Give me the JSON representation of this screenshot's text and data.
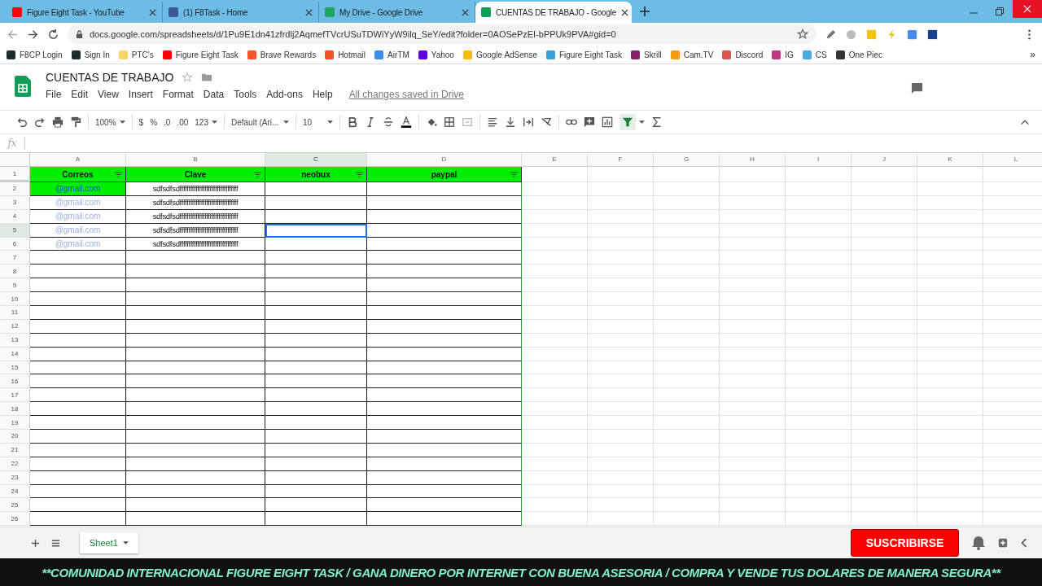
{
  "browser": {
    "tabs": [
      {
        "title": "Figure Eight Task - YouTube",
        "selected": false,
        "color": "#ff0000"
      },
      {
        "title": "(1) F8Task - Home",
        "selected": false,
        "color": "#3b5998"
      },
      {
        "title": "My Drive - Google Drive",
        "selected": false,
        "color": "#1fa463"
      },
      {
        "title": "CUENTAS DE TRABAJO - Google",
        "selected": true,
        "color": "#0f9d58"
      }
    ],
    "url": "docs.google.com/spreadsheets/d/1Pu9E1dn41zfrdlj2AqmefTVcrUSuTDWiYyW9ilq_SeY/edit?folder=0AOSePzEI-bPPUk9PVA#gid=0",
    "bookmarks": [
      {
        "label": "F8CP Login",
        "color": "#1e2b2b"
      },
      {
        "label": "Sign In",
        "color": "#1e2b2b"
      },
      {
        "label": "PTC's",
        "color": "#f6d36b"
      },
      {
        "label": "Figure Eight Task",
        "color": "#ff0000"
      },
      {
        "label": "Brave Rewards",
        "color": "#fb542b"
      },
      {
        "label": "Hotmail",
        "color": "#f25022"
      },
      {
        "label": "AirTM",
        "color": "#3a8ee6"
      },
      {
        "label": "Yahoo",
        "color": "#5f01d1"
      },
      {
        "label": "Google AdSense",
        "color": "#fbbc04"
      },
      {
        "label": "Figure Eight Task",
        "color": "#3aa0d8"
      },
      {
        "label": "Skrill",
        "color": "#862165"
      },
      {
        "label": "Cam.TV",
        "color": "#f39c12"
      },
      {
        "label": "Discord",
        "color": "#d9534f"
      },
      {
        "label": "IG",
        "color": "#c13584"
      },
      {
        "label": "CS",
        "color": "#4aa8e0"
      },
      {
        "label": "One Piec",
        "color": "#333333"
      }
    ],
    "more_bookmarks": "»"
  },
  "doc": {
    "title": "CUENTAS DE TRABAJO",
    "menu": [
      "File",
      "Edit",
      "View",
      "Insert",
      "Format",
      "Data",
      "Tools",
      "Add-ons",
      "Help"
    ],
    "save_status": "All changes saved in Drive"
  },
  "toolbar": {
    "zoom": "100%",
    "currency": "$",
    "percent": "%",
    "decrease_decimals": ".0",
    "increase_decimals": ".00",
    "number_format": "123",
    "font": "Default (Ari...",
    "font_size": "10"
  },
  "formula_bar": {
    "label": "fx"
  },
  "sheet": {
    "columns": [
      {
        "letter": "A",
        "selected": false
      },
      {
        "letter": "B",
        "selected": false
      },
      {
        "letter": "C",
        "selected": true
      },
      {
        "letter": "D",
        "selected": false
      },
      {
        "letter": "E",
        "selected": false
      },
      {
        "letter": "F",
        "selected": false
      },
      {
        "letter": "G",
        "selected": false
      },
      {
        "letter": "H",
        "selected": false
      },
      {
        "letter": "I",
        "selected": false
      },
      {
        "letter": "J",
        "selected": false
      },
      {
        "letter": "K",
        "selected": false
      },
      {
        "letter": "L",
        "selected": false
      }
    ],
    "header_row": {
      "number": "1",
      "labels": [
        "Correos",
        "Clave",
        "neobux",
        "paypal"
      ]
    },
    "rows": [
      {
        "number": "2",
        "email": "@gmail.com",
        "email_highlighted": true,
        "clave": "sdfsdfsdfffffffffffffffffffffffffffffffff",
        "selected": false
      },
      {
        "number": "3",
        "email": "@gmail.com",
        "email_highlighted": false,
        "clave": "sdfsdfsdfffffffffffffffffffffffffffffffff",
        "selected": false
      },
      {
        "number": "4",
        "email": "@gmail.com",
        "email_highlighted": false,
        "clave": "sdfsdfsdfffffffffffffffffffffffffffffffff",
        "selected": false
      },
      {
        "number": "5",
        "email": "@gmail.com",
        "email_highlighted": false,
        "clave": "sdfsdfsdfffffffffffffffffffffffffffffffff",
        "selected": true
      },
      {
        "number": "6",
        "email": "@gmail.com",
        "email_highlighted": false,
        "clave": "sdfsdfsdfffffffffffffffffffffffffffffffff",
        "selected": false
      },
      {
        "number": "7"
      },
      {
        "number": "8"
      },
      {
        "number": "9"
      },
      {
        "number": "10"
      },
      {
        "number": "11"
      },
      {
        "number": "12"
      },
      {
        "number": "13"
      },
      {
        "number": "14"
      },
      {
        "number": "15"
      },
      {
        "number": "16"
      },
      {
        "number": "17"
      },
      {
        "number": "18"
      },
      {
        "number": "19"
      },
      {
        "number": "20"
      },
      {
        "number": "21"
      },
      {
        "number": "22"
      },
      {
        "number": "23"
      },
      {
        "number": "24"
      },
      {
        "number": "25"
      },
      {
        "number": "26"
      }
    ],
    "sheet_tabs": [
      {
        "label": "Sheet1",
        "selected": true
      }
    ]
  },
  "overlay": {
    "subscribe": "SUSCRIBIRSE",
    "banner": "**COMUNIDAD INTERNACIONAL FIGURE EIGHT TASK / GANA DINERO POR INTERNET CON BUENA ASESORIA / COMPRA Y VENDE TUS DOLARES DE MANERA SEGURA**"
  }
}
